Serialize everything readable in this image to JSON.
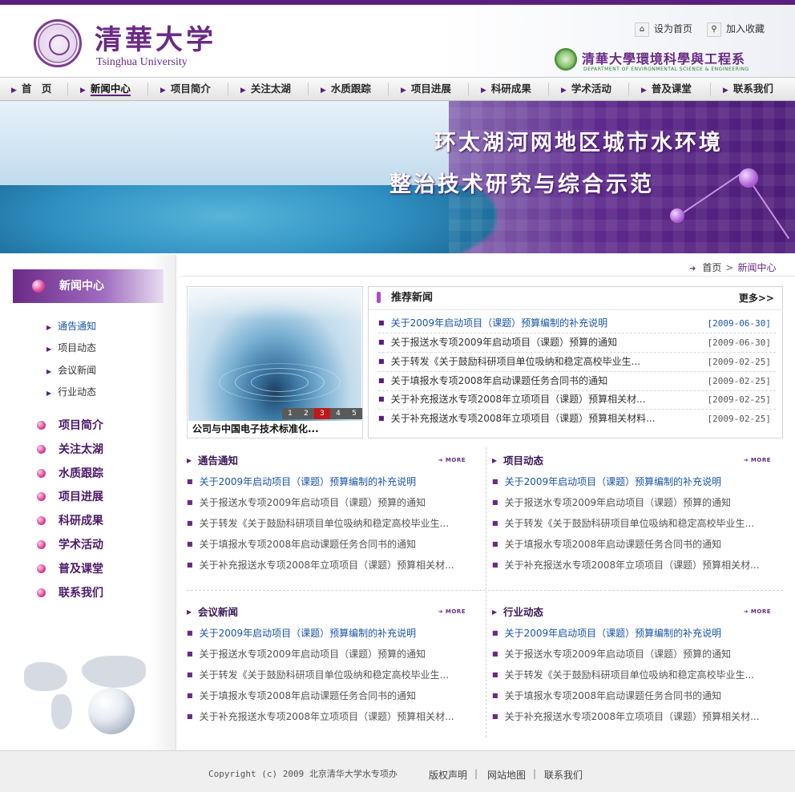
{
  "brand": {
    "name_cn": "清華大学",
    "name_en": "Tsinghua University",
    "dept_cn": "清華大學環境科學與工程系",
    "dept_en": "DEPARTMENT OF ENVIRONMENTAL SCIENCE & ENGINEERING"
  },
  "top_links": {
    "home": "设为首页",
    "favorite": "加入收藏"
  },
  "nav": [
    {
      "label": "首　页"
    },
    {
      "label": "新闻中心"
    },
    {
      "label": "项目简介"
    },
    {
      "label": "关注太湖"
    },
    {
      "label": "水质跟踪"
    },
    {
      "label": "项目进展"
    },
    {
      "label": "科研成果"
    },
    {
      "label": "学术活动"
    },
    {
      "label": "普及课堂"
    },
    {
      "label": "联系我们"
    }
  ],
  "banner": {
    "line1": "环太湖河网地区城市水环境",
    "line2": "整治技术研究与综合示范"
  },
  "sidebar": {
    "heading": "新闻中心",
    "sub_items": [
      "通告通知",
      "项目动态",
      "会议新闻",
      "行业动态"
    ],
    "main_items": [
      "项目简介",
      "关注太湖",
      "水质跟踪",
      "项目进展",
      "科研成果",
      "学术活动",
      "普及课堂",
      "联系我们"
    ]
  },
  "breadcrumb": {
    "home": "首页",
    "separator": ">",
    "current": "新闻中心"
  },
  "slideshow": {
    "caption": "公司与中国电子技术标准化...",
    "pages": [
      "1",
      "2",
      "3",
      "4",
      "5"
    ],
    "active_page": "3"
  },
  "recommended": {
    "title": "推荐新闻",
    "more": "更多>>",
    "items": [
      {
        "title": "关于2009年启动项目（课题）预算编制的补充说明",
        "date": "[2009-06-30]"
      },
      {
        "title": "关于报送水专项2009年启动项目（课题）预算的通知",
        "date": "[2009-06-30]"
      },
      {
        "title": "关于转发《关于鼓励科研项目单位吸纳和稳定高校毕业生...",
        "date": "[2009-02-25]"
      },
      {
        "title": "关于填报水专项2008年启动课题任务合同书的通知",
        "date": "[2009-02-25]"
      },
      {
        "title": "关于补充报送水专项2008年立项项目（课题）预算相关材...",
        "date": "[2009-02-25]"
      },
      {
        "title": "关于补充报送水专项2008年立项项目（课题）预算相关材料...",
        "date": "[2009-02-25]"
      }
    ]
  },
  "sections": [
    {
      "title": "通告通知",
      "more": "MORE",
      "items": [
        "关于2009年启动项目（课题）预算编制的补充说明",
        "关于报送水专项2009年启动项目（课题）预算的通知",
        "关于转发《关于鼓励科研项目单位吸纳和稳定高校毕业生...",
        "关于填报水专项2008年启动课题任务合同书的通知",
        "关于补充报送水专项2008年立项项目（课题）预算相关材..."
      ]
    },
    {
      "title": "项目动态",
      "more": "MORE",
      "items": [
        "关于2009年启动项目（课题）预算编制的补充说明",
        "关于报送水专项2009年启动项目（课题）预算的通知",
        "关于转发《关于鼓励科研项目单位吸纳和稳定高校毕业生...",
        "关于填报水专项2008年启动课题任务合同书的通知",
        "关于补充报送水专项2008年立项项目（课题）预算相关材..."
      ]
    },
    {
      "title": "会议新闻",
      "more": "MORE",
      "items": [
        "关于2009年启动项目（课题）预算编制的补充说明",
        "关于报送水专项2009年启动项目（课题）预算的通知",
        "关于转发《关于鼓励科研项目单位吸纳和稳定高校毕业生...",
        "关于填报水专项2008年启动课题任务合同书的通知",
        "关于补充报送水专项2008年立项项目（课题）预算相关材..."
      ]
    },
    {
      "title": "行业动态",
      "more": "MORE",
      "items": [
        "关于2009年启动项目（课题）预算编制的补充说明",
        "关于报送水专项2009年启动项目（课题）预算的通知",
        "关于转发《关于鼓励科研项目单位吸纳和稳定高校毕业生...",
        "关于填报水专项2008年启动课题任务合同书的通知",
        "关于补充报送水专项2008年立项项目（课题）预算相关材..."
      ]
    }
  ],
  "footer": {
    "copyright": "Copyright (c) 2009 北京清华大学水专项办",
    "links": [
      "版权声明",
      "网站地图",
      "联系我们"
    ],
    "separator": "|"
  },
  "colors": {
    "accent": "#5b1e7d",
    "link_blue": "#1a55a8",
    "bullet_pink": "#e0479a"
  }
}
